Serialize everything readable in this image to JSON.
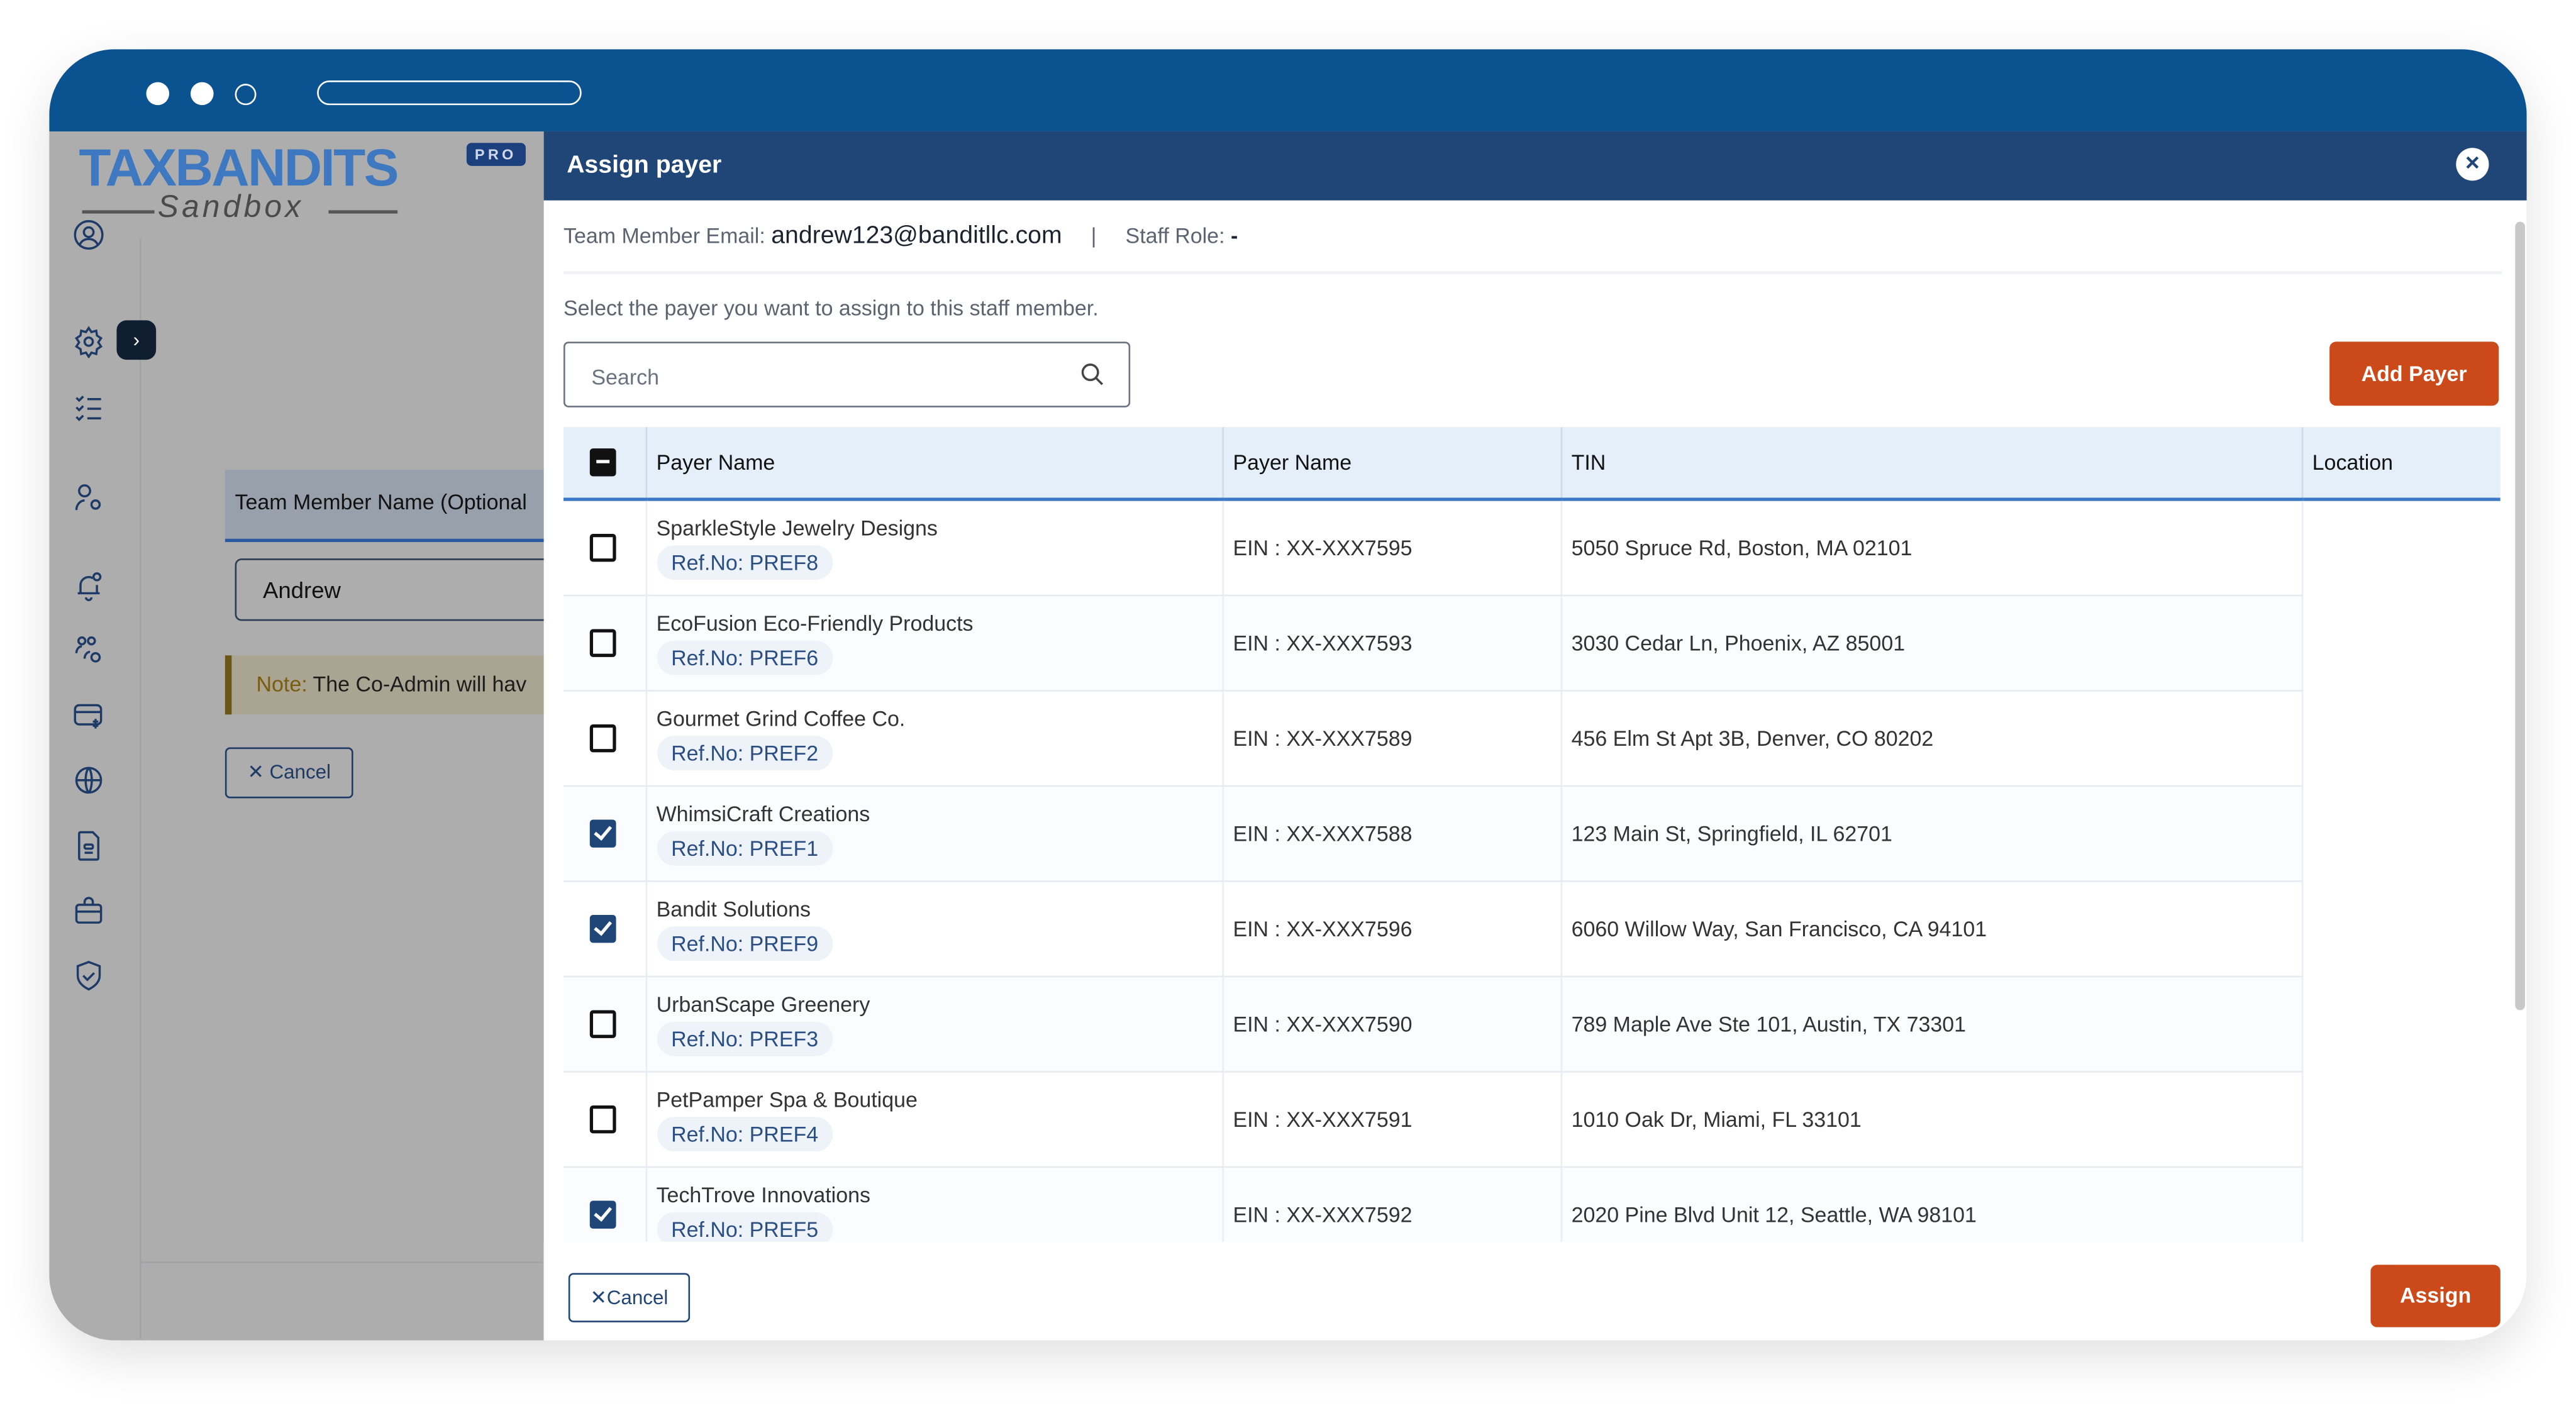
{
  "window": {
    "url_bar_value": ""
  },
  "app": {
    "logo_text": "TAXBANDITS",
    "logo_subtext": "Sandbox",
    "pro_badge": "PRO",
    "sidebar_icons": [
      "user-circle-icon",
      "gear-icon",
      "checklist-icon",
      "user-settings-icon",
      "bell-icon",
      "team-settings-icon",
      "billing-icon",
      "globe-icon",
      "document-icon",
      "briefcase-icon",
      "shield-check-icon"
    ],
    "expand_label": "›",
    "form": {
      "team_member_name_label": "Team Member Name (Optional",
      "team_member_name_value": "Andrew",
      "note_prefix": "Note:",
      "note_text": " The Co-Admin will hav",
      "cancel_label": "Cancel"
    }
  },
  "modal": {
    "title": "Assign payer",
    "close_icon": "×",
    "email_label": "Team Member Email:",
    "email_value": "andrew123@banditllc.com",
    "separator": "|",
    "role_label": "Staff Role:",
    "role_value": "-",
    "instruction": "Select the payer you want to assign to this staff member.",
    "search": {
      "placeholder": "Search",
      "value": ""
    },
    "add_payer_label": "Add Payer",
    "table": {
      "columns": [
        "Payer Name",
        "Payer Name",
        "TIN",
        "Location"
      ],
      "select_all_state": "partial",
      "rows": [
        {
          "name": "SparkleStyle Jewelry Designs",
          "ref": "Ref.No: PREF8",
          "tin": "EIN : XX-XXX7595",
          "address": "5050 Spruce Rd, Boston, MA 02101",
          "checked": false
        },
        {
          "name": "EcoFusion Eco-Friendly Products",
          "ref": "Ref.No: PREF6",
          "tin": "EIN : XX-XXX7593",
          "address": "3030 Cedar Ln, Phoenix, AZ 85001",
          "checked": false
        },
        {
          "name": "Gourmet Grind Coffee Co.",
          "ref": "Ref.No: PREF2",
          "tin": "EIN : XX-XXX7589",
          "address": "456 Elm St Apt 3B, Denver, CO 80202",
          "checked": false
        },
        {
          "name": "WhimsiCraft Creations",
          "ref": "Ref.No: PREF1",
          "tin": "EIN : XX-XXX7588",
          "address": "123 Main St, Springfield, IL 62701",
          "checked": true
        },
        {
          "name": "Bandit Solutions",
          "ref": "Ref.No: PREF9",
          "tin": "EIN : XX-XXX7596",
          "address": "6060 Willow Way, San Francisco, CA 94101",
          "checked": true
        },
        {
          "name": "UrbanScape Greenery",
          "ref": "Ref.No: PREF3",
          "tin": "EIN : XX-XXX7590",
          "address": "789 Maple Ave Ste 101, Austin, TX 73301",
          "checked": false
        },
        {
          "name": "PetPamper Spa & Boutique",
          "ref": "Ref.No: PREF4",
          "tin": "EIN : XX-XXX7591",
          "address": "1010 Oak Dr, Miami, FL 33101",
          "checked": false
        },
        {
          "name": "TechTrove Innovations",
          "ref": "Ref.No: PREF5",
          "tin": "EIN : XX-XXX7592",
          "address": "2020 Pine Blvd Unit 12, Seattle, WA 98101",
          "checked": true
        }
      ]
    },
    "footer": {
      "cancel_label": "Cancel",
      "assign_label": "Assign"
    }
  },
  "colors": {
    "titlebar": "#0b5291",
    "modal_header": "#1f4677",
    "accent_orange": "#cc4a1a",
    "table_header_bg": "#e4effa",
    "header_underline": "#3c78c8"
  }
}
